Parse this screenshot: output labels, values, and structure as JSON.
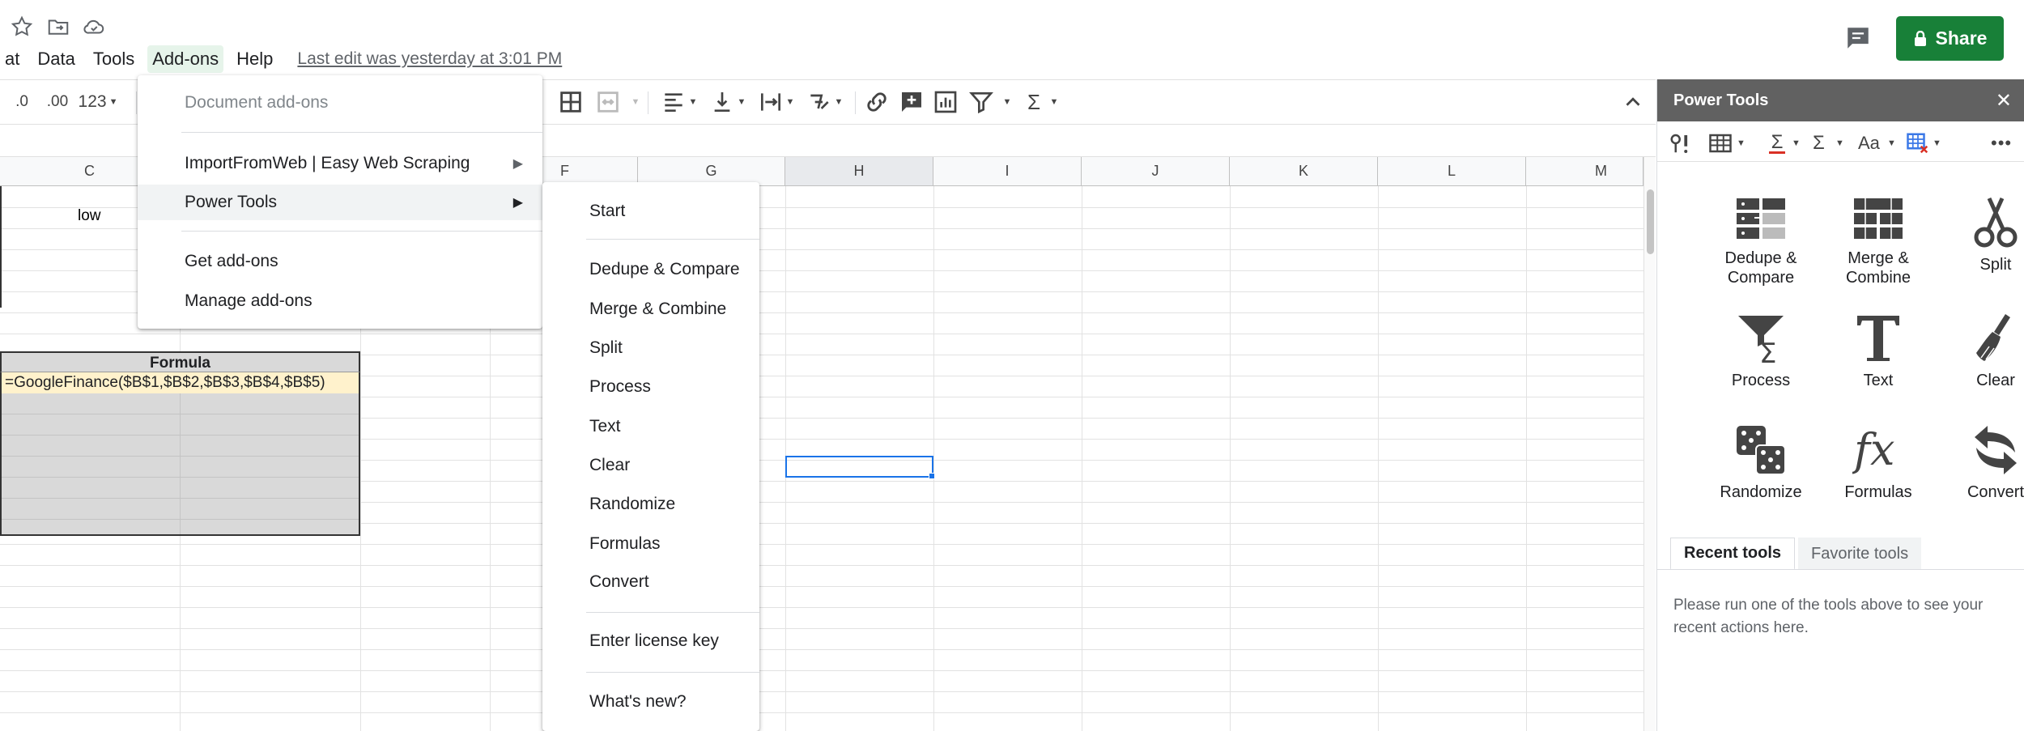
{
  "header": {
    "menus": [
      "at",
      "Data",
      "Tools",
      "Add-ons",
      "Help"
    ],
    "active_menu": "Add-ons",
    "last_edit": "Last edit was yesterday at 3:01 PM",
    "share_label": "Share"
  },
  "toolbar": {
    "decrease_decimal": ".0",
    "increase_decimal": ".00",
    "more_formats": "123"
  },
  "grid": {
    "columns": [
      "C",
      "F",
      "G",
      "H",
      "I",
      "J",
      "K",
      "L",
      "M"
    ],
    "selected_column": "H",
    "cells": {
      "low": "low",
      "formula_header": "Formula",
      "formula": "=GoogleFinance($B$1,$B$2,$B$3,$B$4,$B$5)"
    }
  },
  "addons_menu": {
    "items": [
      {
        "label": "Document add-ons",
        "disabled": true
      },
      {
        "label": "ImportFromWeb | Easy Web Scraping",
        "submenu": true
      },
      {
        "label": "Power Tools",
        "submenu": true,
        "hover": true
      },
      {
        "label": "Get add-ons"
      },
      {
        "label": "Manage add-ons"
      }
    ]
  },
  "power_tools_menu": {
    "items": [
      "Start",
      "Dedupe & Compare",
      "Merge & Combine",
      "Split",
      "Process",
      "Text",
      "Clear",
      "Randomize",
      "Formulas",
      "Convert",
      "Enter license key",
      "What's new?"
    ]
  },
  "sidebar": {
    "title": "Power Tools",
    "tools": [
      {
        "label": "Dedupe & Compare",
        "icon": "dedupe-icon"
      },
      {
        "label": "Merge & Combine",
        "icon": "merge-icon"
      },
      {
        "label": "Split",
        "icon": "scissors-icon"
      },
      {
        "label": "Process",
        "icon": "funnel-sigma-icon"
      },
      {
        "label": "Text",
        "icon": "text-t-icon"
      },
      {
        "label": "Clear",
        "icon": "broom-icon"
      },
      {
        "label": "Randomize",
        "icon": "dice-icon"
      },
      {
        "label": "Formulas",
        "icon": "fx-icon"
      },
      {
        "label": "Convert",
        "icon": "convert-arrows-icon"
      }
    ],
    "tabs": [
      "Recent tools",
      "Favorite tools"
    ],
    "recent_message": "Please run one of the tools above to see your recent actions here.",
    "toolbar": {
      "aa": "Aa"
    }
  },
  "colors": {
    "share_green": "#188038",
    "sidebar_header": "#616161",
    "selection_blue": "#1a73e8",
    "formula_bg": "#fff2cc",
    "grey_fill": "#d9d9d9"
  }
}
